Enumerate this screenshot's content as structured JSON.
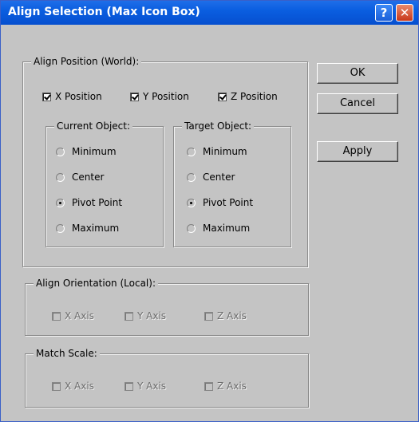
{
  "window": {
    "title": "Align Selection (Max Icon Box)",
    "help_glyph": "?",
    "close_glyph": "✕"
  },
  "align_position": {
    "legend": "Align Position (World):",
    "x_label": "X Position",
    "x_checked": true,
    "y_label": "Y Position",
    "y_checked": true,
    "z_label": "Z Position",
    "z_checked": true,
    "current": {
      "legend": "Current Object:",
      "options": [
        "Minimum",
        "Center",
        "Pivot Point",
        "Maximum"
      ],
      "selected": "Pivot Point"
    },
    "target": {
      "legend": "Target Object:",
      "options": [
        "Minimum",
        "Center",
        "Pivot Point",
        "Maximum"
      ],
      "selected": "Pivot Point"
    }
  },
  "align_orientation": {
    "legend": "Align Orientation (Local):",
    "x_label": "X Axis",
    "y_label": "Y Axis",
    "z_label": "Z Axis",
    "enabled": false
  },
  "match_scale": {
    "legend": "Match Scale:",
    "x_label": "X Axis",
    "y_label": "Y Axis",
    "z_label": "Z Axis",
    "enabled": false
  },
  "buttons": {
    "ok": "OK",
    "cancel": "Cancel",
    "apply": "Apply"
  }
}
